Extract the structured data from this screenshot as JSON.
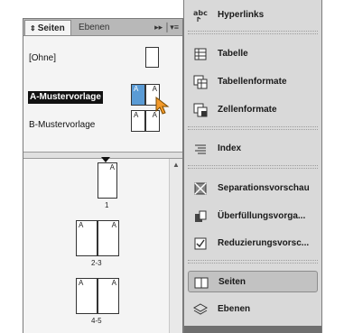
{
  "pages_panel": {
    "tabs": [
      {
        "label": "Seiten",
        "active": true
      },
      {
        "label": "Ebenen",
        "active": false
      }
    ],
    "tab_controls": "▸▸ │▾≡",
    "masters": [
      {
        "label": "[Ohne]",
        "selected": false,
        "thumb_letters": []
      },
      {
        "label": "A-Mustervorlage",
        "selected": true,
        "thumb_letters": [
          "A",
          "A"
        ]
      },
      {
        "label": "B-Mustervorlage",
        "selected": false,
        "thumb_letters": [
          "A",
          "A"
        ]
      }
    ],
    "pages": [
      {
        "number": "1",
        "letters": [
          "A"
        ]
      },
      {
        "number": "2-3",
        "letters": [
          "A",
          "A"
        ]
      },
      {
        "number": "4-5",
        "letters": [
          "A",
          "A"
        ]
      }
    ]
  },
  "dock": {
    "items": [
      {
        "label": "Hyperlinks",
        "icon": "hyperlinks-icon"
      },
      {
        "label": "Tabelle",
        "icon": "table-icon"
      },
      {
        "label": "Tabellenformate",
        "icon": "table-styles-icon"
      },
      {
        "label": "Zellenformate",
        "icon": "cell-styles-icon"
      },
      {
        "label": "Index",
        "icon": "index-icon"
      },
      {
        "label": "Separationsvorschau",
        "icon": "separations-preview-icon"
      },
      {
        "label": "Überfüllungsvorga...",
        "icon": "trap-presets-icon"
      },
      {
        "label": "Reduzierungsvorsc...",
        "icon": "flattener-preview-icon"
      },
      {
        "label": "Seiten",
        "icon": "pages-icon",
        "active": true
      },
      {
        "label": "Ebenen",
        "icon": "layers-icon"
      }
    ]
  },
  "colors": {
    "selection": "#111111",
    "accent_orange": "#f39a2a",
    "selected_thumb": "#5a9bd5"
  }
}
